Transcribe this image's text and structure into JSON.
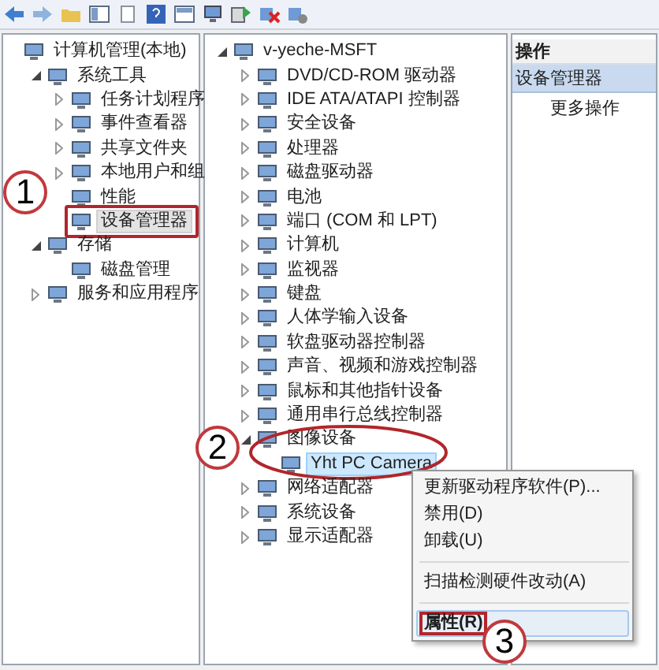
{
  "left_tree": [
    {
      "label": "计算机管理(本地)",
      "selected": false,
      "annotated": false,
      "children": [
        {
          "label": "系统工具",
          "expanded": true,
          "selected": false,
          "annotated": false,
          "children": [
            {
              "label": "任务计划程序",
              "expanded": false,
              "selected": false,
              "annotated": false
            },
            {
              "label": "事件查看器",
              "expanded": false,
              "selected": false,
              "annotated": false
            },
            {
              "label": "共享文件夹",
              "expanded": false,
              "selected": false,
              "annotated": false
            },
            {
              "label": "本地用户和组",
              "expanded": false,
              "selected": false,
              "annotated": false
            },
            {
              "label": "性能",
              "selected": false,
              "annotated": false
            },
            {
              "label": "设备管理器",
              "selected": true,
              "annotated": true
            }
          ]
        },
        {
          "label": "存储",
          "expanded": true,
          "selected": false,
          "annotated": false,
          "children": [
            {
              "label": "磁盘管理",
              "selected": false,
              "annotated": false
            }
          ]
        },
        {
          "label": "服务和应用程序",
          "expanded": false,
          "selected": false,
          "annotated": false
        }
      ]
    }
  ],
  "device_tree": [
    {
      "label": "v-yeche-MSFT",
      "expanded": true,
      "selected": false,
      "annotated": false,
      "children": [
        {
          "label": "DVD/CD-ROM 驱动器",
          "expanded": false,
          "selected": false,
          "annotated": false
        },
        {
          "label": "IDE ATA/ATAPI 控制器",
          "expanded": false,
          "selected": false,
          "annotated": false
        },
        {
          "label": "安全设备",
          "expanded": false,
          "selected": false,
          "annotated": false
        },
        {
          "label": "处理器",
          "expanded": false,
          "selected": false,
          "annotated": false
        },
        {
          "label": "磁盘驱动器",
          "expanded": false,
          "selected": false,
          "annotated": false
        },
        {
          "label": "电池",
          "expanded": false,
          "selected": false,
          "annotated": false
        },
        {
          "label": "端口 (COM 和 LPT)",
          "expanded": false,
          "selected": false,
          "annotated": false
        },
        {
          "label": "计算机",
          "expanded": false,
          "selected": false,
          "annotated": false
        },
        {
          "label": "监视器",
          "expanded": false,
          "selected": false,
          "annotated": false
        },
        {
          "label": "键盘",
          "expanded": false,
          "selected": false,
          "annotated": false
        },
        {
          "label": "人体学输入设备",
          "expanded": false,
          "selected": false,
          "annotated": false
        },
        {
          "label": "软盘驱动器控制器",
          "expanded": false,
          "selected": false,
          "annotated": false
        },
        {
          "label": "声音、视频和游戏控制器",
          "expanded": false,
          "selected": false,
          "annotated": false
        },
        {
          "label": "鼠标和其他指针设备",
          "expanded": false,
          "selected": false,
          "annotated": false
        },
        {
          "label": "通用串行总线控制器",
          "expanded": false,
          "selected": false,
          "annotated": false
        },
        {
          "label": "图像设备",
          "expanded": true,
          "selected": false,
          "annotated": true,
          "children": [
            {
              "label": "Yht PC Camera",
              "selected": true,
              "annotated": false
            }
          ]
        },
        {
          "label": "网络适配器",
          "expanded": false,
          "selected": false,
          "annotated": false
        },
        {
          "label": "系统设备",
          "expanded": false,
          "selected": false,
          "annotated": false
        },
        {
          "label": "显示适配器",
          "expanded": false,
          "selected": false,
          "annotated": false
        }
      ]
    }
  ],
  "actions_pane": {
    "title": "操作",
    "items": [
      {
        "label": "设备管理器",
        "kind": "section"
      },
      {
        "label": "更多操作",
        "kind": "action"
      }
    ]
  },
  "context_menu": [
    {
      "kind": "item",
      "label": "更新驱动程序软件(P)...",
      "selected": false,
      "default": false,
      "annotated": false
    },
    {
      "kind": "item",
      "label": "禁用(D)",
      "selected": false,
      "default": false,
      "annotated": false
    },
    {
      "kind": "item",
      "label": "卸载(U)",
      "selected": false,
      "default": false,
      "annotated": false
    },
    {
      "kind": "separator"
    },
    {
      "kind": "item",
      "label": "扫描检测硬件改动(A)",
      "selected": false,
      "default": false,
      "annotated": false
    },
    {
      "kind": "separator"
    },
    {
      "kind": "item",
      "label": "属性(R)",
      "selected": true,
      "default": true,
      "annotated": true
    }
  ],
  "annotations": [
    {
      "label": "1"
    },
    {
      "label": "2"
    },
    {
      "label": "3"
    }
  ]
}
